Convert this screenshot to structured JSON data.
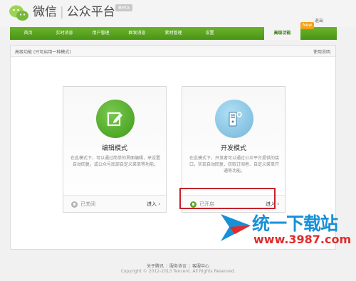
{
  "header": {
    "brand_name": "微信",
    "brand_sub": "公众平台",
    "beta_label": "Beta",
    "logout_label": "退出"
  },
  "nav": {
    "items": [
      {
        "label": "首页"
      },
      {
        "label": "实时消息"
      },
      {
        "label": "用户管理"
      },
      {
        "label": "群发消息"
      },
      {
        "label": "素材管理"
      },
      {
        "label": "设置"
      },
      {
        "label": "高级功能"
      }
    ],
    "active_index": 6,
    "new_badge": "New"
  },
  "mode_bar": {
    "title": "高级功能 (只可启用一种模式)",
    "help_link": "使用说明"
  },
  "cards": [
    {
      "title": "编辑模式",
      "description": "在此模式下，可以通过简单的界面编辑，来设置自动回复，或公众号底部自定义菜单等功能。",
      "status": "已关闭",
      "enter": "进入"
    },
    {
      "title": "开发模式",
      "description": "在此模式下，开发者可以通过公众平台提供的接口，实现自动回复、获取订阅者、自定义菜单开通等功能。",
      "status": "已开启",
      "enter": "进入"
    }
  ],
  "footer": {
    "link_about": "关于腾讯",
    "link_agreement": "服务协议",
    "link_help": "客服中心",
    "copyright": "Copyright © 2012-2013 Tencent. All Rights Reserved."
  },
  "watermark": {
    "text": "统一下载站",
    "url": "www.3987.com"
  },
  "colors": {
    "nav_green": "#5aa41f",
    "highlight_red": "#c4222d",
    "badge_orange": "#f1a31a"
  }
}
